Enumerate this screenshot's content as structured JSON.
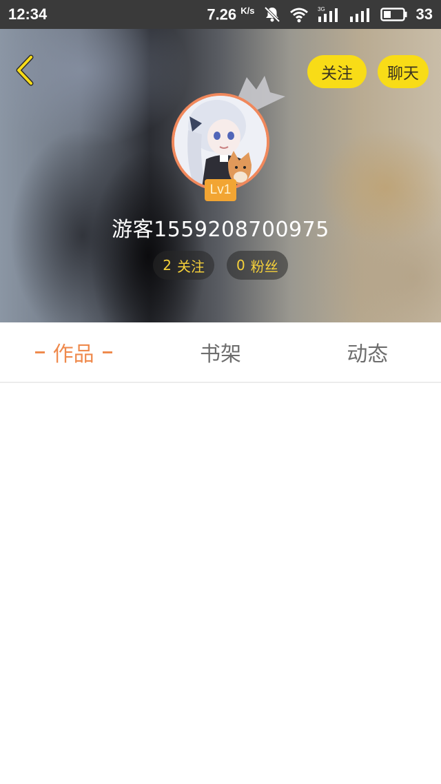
{
  "status_bar": {
    "time": "12:34",
    "network_speed": "7.26",
    "network_speed_unit": "K/s",
    "network_type": "3G",
    "battery_level": "33",
    "icons": [
      "muted-bell-icon",
      "wifi-icon",
      "signal-3g-icon",
      "signal-icon",
      "battery-icon"
    ]
  },
  "header": {
    "back_icon": "chevron-left-icon",
    "follow_label": "关注",
    "chat_label": "聊天",
    "accent_color": "#f8dc17"
  },
  "profile": {
    "level": "Lv1",
    "username": "游客1559208700975",
    "following_count": "2",
    "following_label": "关注",
    "followers_count": "0",
    "followers_label": "粉丝"
  },
  "tabs": [
    {
      "label": "作品",
      "active": true
    },
    {
      "label": "书架",
      "active": false
    },
    {
      "label": "动态",
      "active": false
    }
  ],
  "colors": {
    "tab_active": "#ef8a4d",
    "stat_text": "#f6d13a",
    "level_badge": "#f2a533",
    "avatar_ring": "#f0885c"
  }
}
